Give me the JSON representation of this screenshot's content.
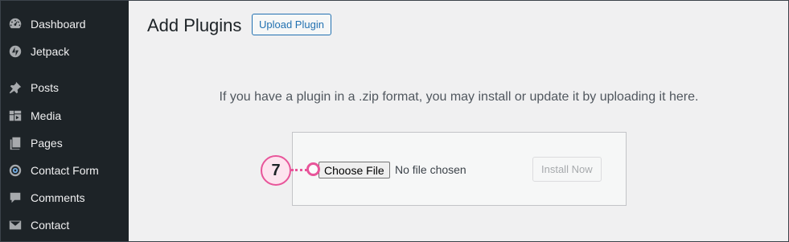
{
  "sidebar": {
    "items": [
      {
        "label": "Dashboard",
        "icon": "dashboard-icon"
      },
      {
        "label": "Jetpack",
        "icon": "jetpack-icon"
      },
      {
        "label": "Posts",
        "icon": "pin-icon"
      },
      {
        "label": "Media",
        "icon": "media-icon"
      },
      {
        "label": "Pages",
        "icon": "pages-icon"
      },
      {
        "label": "Contact Form",
        "icon": "contact-form-icon"
      },
      {
        "label": "Comments",
        "icon": "comment-icon"
      },
      {
        "label": "Contact",
        "icon": "mail-icon"
      }
    ]
  },
  "header": {
    "title": "Add Plugins",
    "upload_label": "Upload Plugin"
  },
  "upload": {
    "help_text": "If you have a plugin in a .zip format, you may install or update it by uploading it here.",
    "choose_file_label": "Choose File",
    "no_file_text": "No file chosen",
    "install_label": "Install Now"
  },
  "callout": {
    "number": "7",
    "color": "#e8559a"
  },
  "colors": {
    "sidebar_bg": "#1d2327",
    "accent": "#2271b1",
    "page_bg": "#f0f0f1"
  }
}
